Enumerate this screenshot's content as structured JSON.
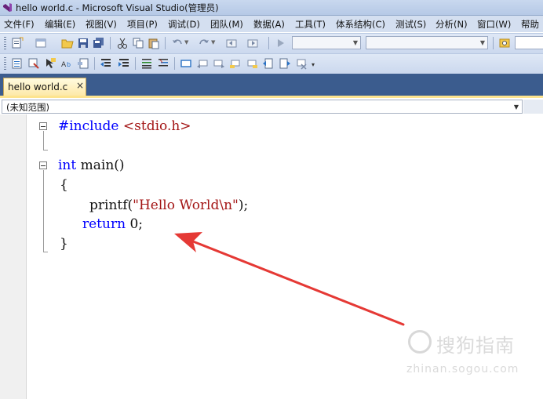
{
  "window": {
    "title": "hello world.c - Microsoft Visual Studio(管理员)"
  },
  "menu": [
    {
      "label": "文件(F)",
      "name": "menu-file"
    },
    {
      "label": "编辑(E)",
      "name": "menu-edit"
    },
    {
      "label": "视图(V)",
      "name": "menu-view"
    },
    {
      "label": "项目(P)",
      "name": "menu-project"
    },
    {
      "label": "调试(D)",
      "name": "menu-debug"
    },
    {
      "label": "团队(M)",
      "name": "menu-team"
    },
    {
      "label": "数据(A)",
      "name": "menu-data"
    },
    {
      "label": "工具(T)",
      "name": "menu-tools"
    },
    {
      "label": "体系结构(C)",
      "name": "menu-architecture"
    },
    {
      "label": "测试(S)",
      "name": "menu-test"
    },
    {
      "label": "分析(N)",
      "name": "menu-analyze"
    },
    {
      "label": "窗口(W)",
      "name": "menu-window"
    },
    {
      "label": "帮助",
      "name": "menu-help"
    }
  ],
  "tab": {
    "label": "hello  world.c",
    "close": "×"
  },
  "scope": {
    "value": "(未知范围)"
  },
  "code": {
    "l1_kw": "#include",
    "l1_rest": " <stdio.h>",
    "l3_kw": "int",
    "l3_rest": " main()",
    "l4": "{",
    "l5_fn": "printf(",
    "l5_str": "\"Hello World\\n\"",
    "l5_end": ");",
    "l6_kw": "return",
    "l6_rest": " 0;",
    "l7": "}"
  },
  "watermark": {
    "text": "搜狗指南",
    "url": "zhinan.sogou.com"
  },
  "colors": {
    "keyword": "#0000ff",
    "string": "#a31515",
    "arrow": "#e53935",
    "tabstrip": "#3b5c8e"
  }
}
